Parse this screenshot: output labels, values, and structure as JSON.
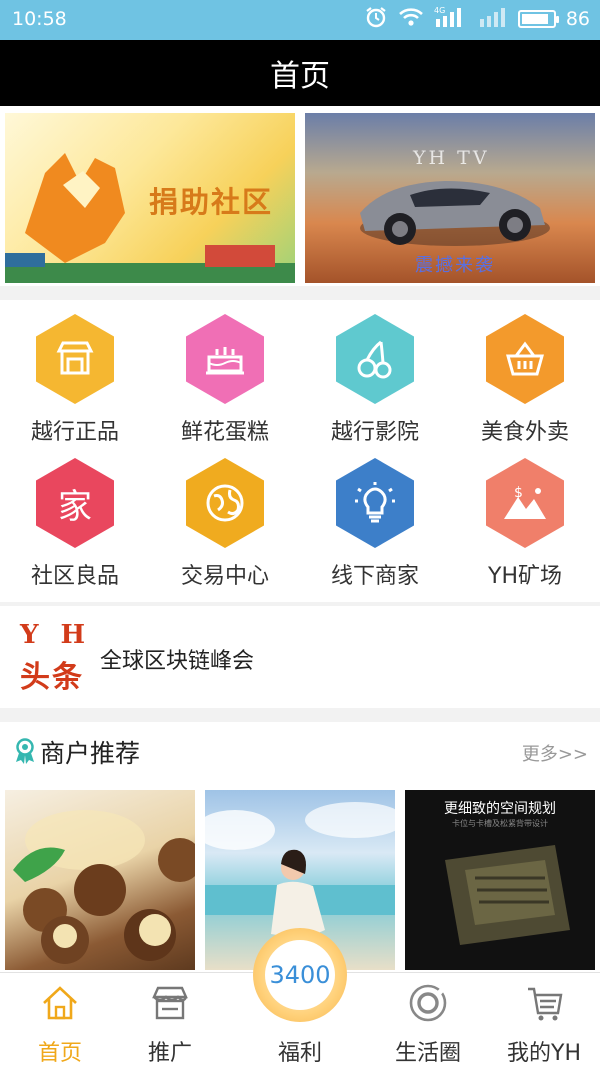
{
  "status_bar": {
    "time": "10:58",
    "network": "4G",
    "battery": "86",
    "battery_level": 0.86
  },
  "title": "首页",
  "banners": [
    {
      "text": "捐助社区"
    },
    {
      "logo": "YH TV",
      "text": "震撼来袭"
    }
  ],
  "grid": [
    {
      "label": "越行正品",
      "icon": "store-icon",
      "color": "#f5b731"
    },
    {
      "label": "鲜花蛋糕",
      "icon": "cake-icon",
      "color": "#f06fb5"
    },
    {
      "label": "越行影院",
      "icon": "cherry-icon",
      "color": "#5fc9cf"
    },
    {
      "label": "美食外卖",
      "icon": "basket-icon",
      "color": "#f39a2c"
    },
    {
      "label": "社区良品",
      "icon": "home-char-icon",
      "color": "#e9475e",
      "icon_text": "家"
    },
    {
      "label": "交易中心",
      "icon": "globe-icon",
      "color": "#f0ab1f"
    },
    {
      "label": "线下商家",
      "icon": "lightbulb-icon",
      "color": "#3d7fc9"
    },
    {
      "label": "YH矿场",
      "icon": "mountain-dollar-icon",
      "color": "#f07f6a"
    }
  ],
  "headline": {
    "logo_line1": "YH",
    "logo_line2": "头条",
    "text": "全球区块链峰会"
  },
  "merchants": {
    "title": "商户推荐",
    "more": "更多>>",
    "cards": [
      {
        "image": "macadamia-nuts"
      },
      {
        "image": "beach-portrait"
      },
      {
        "image": "storage-bag",
        "title": "更细致的空间规划",
        "subtitle": "卡位与卡槽及松紧背带设计"
      }
    ]
  },
  "bottom_nav": [
    {
      "label": "首页",
      "icon": "home-icon",
      "active": true
    },
    {
      "label": "推广",
      "icon": "shop-icon",
      "active": false
    },
    {
      "label": "福利",
      "icon": "gift-icon",
      "active": false,
      "value": "3400"
    },
    {
      "label": "生活圈",
      "icon": "circle-icon",
      "active": false
    },
    {
      "label": "我的YH",
      "icon": "cart-list-icon",
      "active": false
    }
  ]
}
